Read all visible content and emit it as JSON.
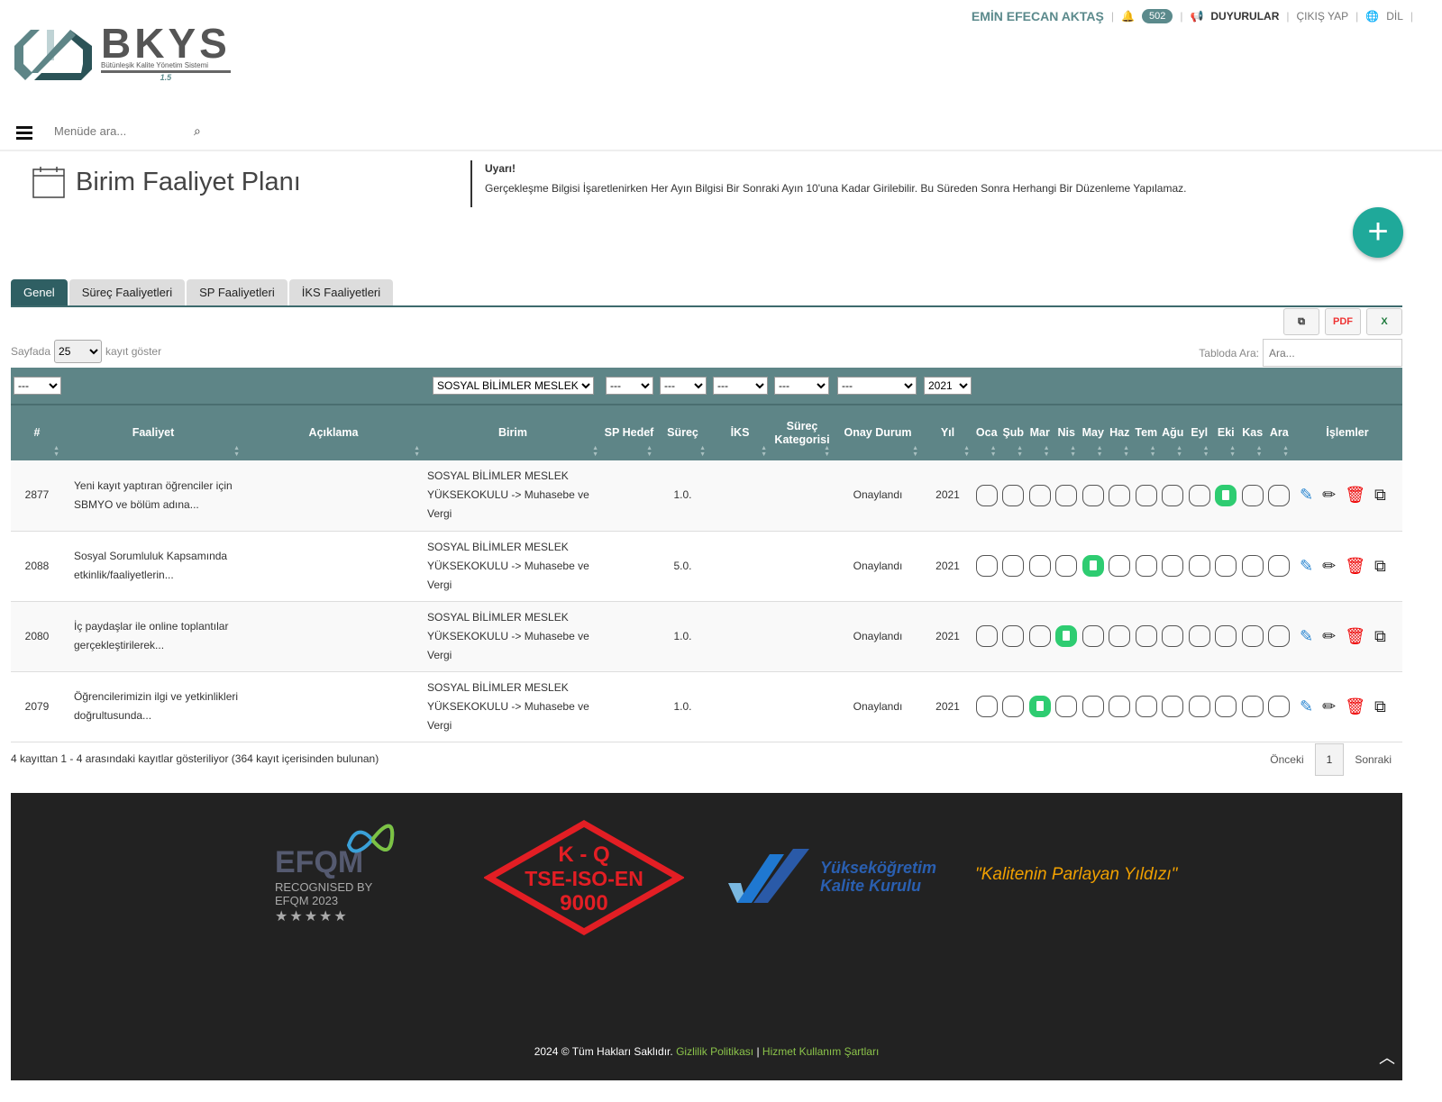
{
  "topbar": {
    "user": "EMİN EFECAN  AKTAŞ",
    "notifications": "502",
    "announcements": "DUYURULAR",
    "logout": "ÇIKIŞ YAP",
    "language": "DİL"
  },
  "logo": {
    "name": "BKYS",
    "subtitle": "Bütünleşik Kalite Yönetim Sistemi",
    "version": "1.5"
  },
  "menu": {
    "search_placeholder": "Menüde ara..."
  },
  "page": {
    "title": "Birim Faaliyet Planı",
    "warning_title": "Uyarı!",
    "warning_text": "Gerçekleşme Bilgisi İşaretlenirken Her Ayın Bilgisi Bir Sonraki Ayın 10'una Kadar Girilebilir. Bu Süreden Sonra Herhangi Bir Düzenleme Yapılamaz."
  },
  "tabs": [
    "Genel",
    "Süreç Faaliyetleri",
    "SP Faaliyetleri",
    "İKS Faaliyetleri"
  ],
  "toolbar": {
    "pdf": "PDF",
    "excel": "X"
  },
  "length": {
    "prefix": "Sayfada",
    "value": "25",
    "suffix": "kayıt göster"
  },
  "search": {
    "label": "Tabloda Ara:",
    "placeholder": "Ara..."
  },
  "filters": {
    "f1": "---",
    "birim": "SOSYAL BİLİMLER MESLEK Y",
    "f3": "---",
    "f4": "---",
    "f5": "---",
    "f6": "---",
    "f7": "---",
    "year": "2021"
  },
  "columns": [
    "#",
    "Faaliyet",
    "Açıklama",
    "Birim",
    "SP Hedef",
    "Süreç",
    "İKS",
    "Süreç Kategorisi",
    "Onay Durum",
    "Yıl",
    "Oca",
    "Şub",
    "Mar",
    "Nis",
    "May",
    "Haz",
    "Tem",
    "Ağu",
    "Eyl",
    "Eki",
    "Kas",
    "Ara",
    "İşlemler"
  ],
  "rows": [
    {
      "id": "2877",
      "faaliyet": "Yeni kayıt yaptıran öğrenciler için SBMYO ve bölüm adına...",
      "aciklama": "",
      "birim": "SOSYAL BİLİMLER MESLEK YÜKSEKOKULU -> Muhasebe ve Vergi",
      "sp": "",
      "surec": "1.0.",
      "iks": "",
      "kategori": "",
      "onay": "Onaylandı",
      "yil": "2021",
      "months": [
        0,
        0,
        0,
        0,
        0,
        0,
        0,
        0,
        0,
        1,
        0,
        0
      ]
    },
    {
      "id": "2088",
      "faaliyet": "Sosyal Sorumluluk Kapsamında etkinlik/faaliyetlerin...",
      "aciklama": "",
      "birim": "SOSYAL BİLİMLER MESLEK YÜKSEKOKULU -> Muhasebe ve Vergi",
      "sp": "",
      "surec": "5.0.",
      "iks": "",
      "kategori": "",
      "onay": "Onaylandı",
      "yil": "2021",
      "months": [
        0,
        0,
        0,
        0,
        1,
        0,
        0,
        0,
        0,
        0,
        0,
        0
      ]
    },
    {
      "id": "2080",
      "faaliyet": "İç paydaşlar ile online toplantılar gerçekleştirilerek...",
      "aciklama": "",
      "birim": "SOSYAL BİLİMLER MESLEK YÜKSEKOKULU -> Muhasebe ve Vergi",
      "sp": "",
      "surec": "1.0.",
      "iks": "",
      "kategori": "",
      "onay": "Onaylandı",
      "yil": "2021",
      "months": [
        0,
        0,
        0,
        1,
        0,
        0,
        0,
        0,
        0,
        0,
        0,
        0
      ]
    },
    {
      "id": "2079",
      "faaliyet": "Öğrencilerimizin ilgi ve yetkinlikleri doğrultusunda...",
      "aciklama": "",
      "birim": "SOSYAL BİLİMLER MESLEK YÜKSEKOKULU -> Muhasebe ve Vergi",
      "sp": "",
      "surec": "1.0.",
      "iks": "",
      "kategori": "",
      "onay": "Onaylandı",
      "yil": "2021",
      "months": [
        0,
        0,
        1,
        0,
        0,
        0,
        0,
        0,
        0,
        0,
        0,
        0
      ]
    }
  ],
  "info": "4 kayıttan 1 - 4 arasındaki kayıtlar gösteriliyor (364 kayıt içerisinden bulunan)",
  "pager": {
    "prev": "Önceki",
    "page": "1",
    "next": "Sonraki"
  },
  "footer": {
    "efqm": "EFQM",
    "efqm_sub1": "RECOGNISED BY",
    "efqm_sub2": "EFQM 2023",
    "stars": "★★★★★",
    "kq1": "K - Q",
    "kq2": "TSE-ISO-EN",
    "kq3": "9000",
    "yok1": "Yükseköğretim",
    "yok2": "Kalite Kurulu",
    "slogan": "\"Kalitenin Parlayan Yıldızı\"",
    "copyright": "2024 © Tüm Hakları Saklıdır.",
    "privacy": "Gizlilik Politikası",
    "sep": "|",
    "terms": "Hizmet Kullanım Şartları"
  },
  "colors": {
    "accent": "#5e8587",
    "add": "#1fa99a",
    "done": "#2ecc71"
  }
}
